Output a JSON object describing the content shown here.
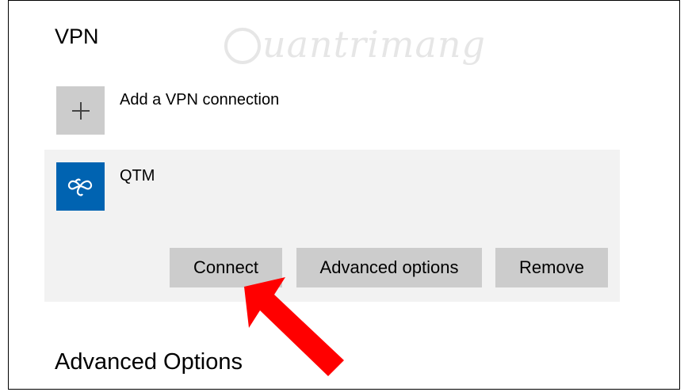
{
  "section": {
    "title": "VPN"
  },
  "watermark": {
    "text": "uantrimang"
  },
  "add_vpn": {
    "label": "Add a VPN connection",
    "icon": "plus-icon"
  },
  "vpn_connections": [
    {
      "name": "QTM",
      "icon": "vpn-infinity-icon",
      "buttons": {
        "connect": "Connect",
        "advanced": "Advanced options",
        "remove": "Remove"
      }
    }
  ],
  "advanced_section": {
    "title": "Advanced Options"
  },
  "colors": {
    "accent": "#0063b1",
    "annotation_arrow": "#ff0000",
    "tile_gray": "#cccccc",
    "selected_bg": "#f2f2f2"
  }
}
